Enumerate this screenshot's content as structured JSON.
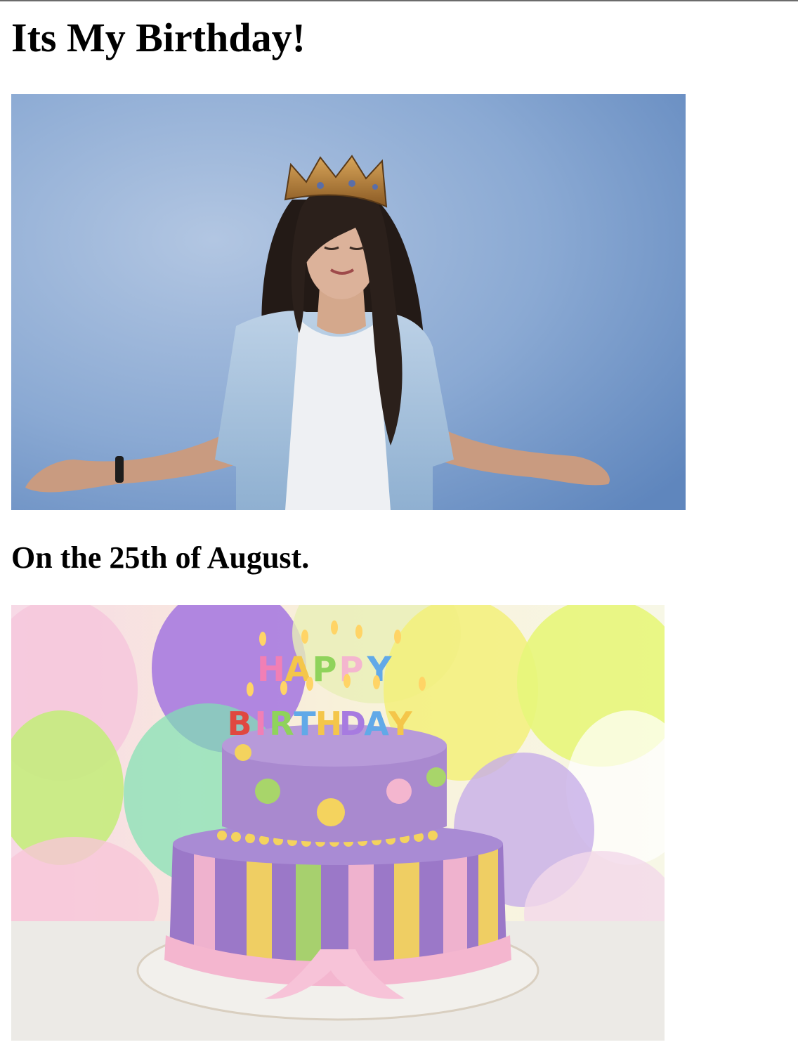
{
  "page": {
    "title": "Its My Birthday!",
    "subtitle": "On the 25th of August."
  },
  "images": {
    "woman_photo": {
      "icon": "birthday-woman-with-crown-image",
      "colors": {
        "background": "#8aa9d3",
        "jacket": "#a9c4df",
        "shirt": "#eef0f3",
        "hair": "#231a16",
        "crown": "#b07a3a"
      }
    },
    "cake_photo": {
      "icon": "birthday-cake-image",
      "candle_text_top": "HAPPY",
      "candle_text_bottom": "BIRTHDAY",
      "colors": {
        "top_tier": "#a989cf",
        "bottom_tier": "#9b78c8",
        "ribbon": "#f4b6cf",
        "stripe_yellow": "#f4d35e",
        "stripe_green": "#a8d56a",
        "board": "#f2f0ec"
      }
    }
  }
}
